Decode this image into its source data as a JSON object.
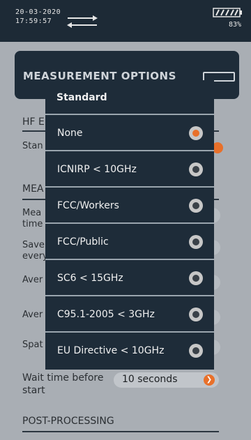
{
  "status": {
    "date": "20-03-2020",
    "time": "17:59:57",
    "battery_pct": "83%"
  },
  "background": {
    "header_title": "MEASUREMENT OPTIONS",
    "hf_label": "HF E",
    "standard_label": "Stan",
    "meas_label": "MEA",
    "rows": [
      "Mea",
      "time",
      "Save",
      "every",
      "Aver",
      "Aver",
      "Spat"
    ],
    "wait_label_1": "Wait time before",
    "wait_label_2": "start",
    "wait_value": "10 seconds",
    "post_processing": "POST-PROCESSING"
  },
  "modal": {
    "title": "Standard",
    "options": [
      {
        "label": "None",
        "selected": true
      },
      {
        "label": "ICNIRP < 10GHz",
        "selected": false
      },
      {
        "label": "FCC/Workers",
        "selected": false
      },
      {
        "label": "FCC/Public",
        "selected": false
      },
      {
        "label": "SC6 < 15GHz",
        "selected": false
      },
      {
        "label": "C95.1-2005 < 3GHz",
        "selected": false
      },
      {
        "label": "EU Directive < 10GHz",
        "selected": false
      }
    ]
  },
  "colors": {
    "accent": "#e8702a",
    "panel": "#1e2c39",
    "dim_bg": "#a9aeb4"
  }
}
